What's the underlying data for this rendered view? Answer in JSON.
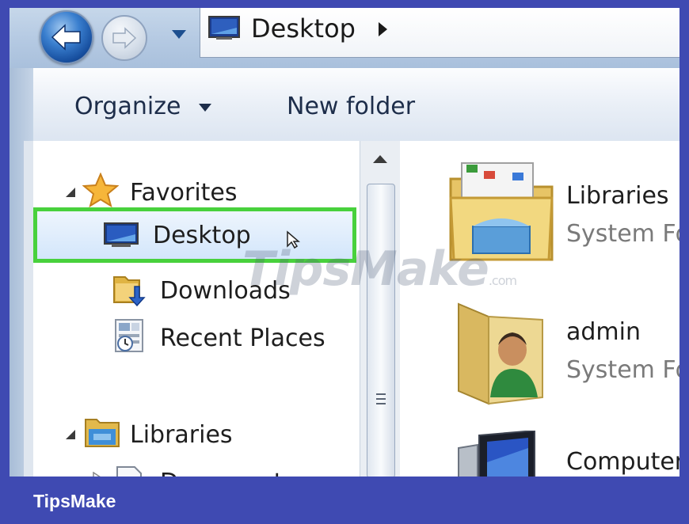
{
  "navigation": {
    "back_icon": "back-arrow-icon",
    "forward_icon": "forward-arrow-icon",
    "recent_pages_icon": "chevron-down-icon"
  },
  "address_bar": {
    "location_icon": "desktop-icon",
    "location": "Desktop",
    "separator_icon": "chevron-right-icon"
  },
  "toolbar": {
    "organize_label": "Organize",
    "new_folder_label": "New folder"
  },
  "nav_pane": {
    "favorites": {
      "label": "Favorites",
      "icon": "star-icon",
      "items": [
        {
          "label": "Desktop",
          "icon": "desktop-icon",
          "selected": true
        },
        {
          "label": "Downloads",
          "icon": "downloads-icon"
        },
        {
          "label": "Recent Places",
          "icon": "recent-places-icon"
        }
      ]
    },
    "libraries": {
      "label": "Libraries",
      "icon": "libraries-icon",
      "items": [
        {
          "label": "Documents",
          "icon": "documents-icon"
        }
      ]
    }
  },
  "content": {
    "items": [
      {
        "name": "Libraries",
        "type": "System Fo",
        "icon": "libraries-folder-icon"
      },
      {
        "name": "admin",
        "type": "System Fo",
        "icon": "user-folder-icon"
      },
      {
        "name": "Computer",
        "type": "",
        "icon": "computer-icon"
      }
    ]
  },
  "watermark": {
    "text": "TipsMake",
    "suffix": ".com"
  },
  "footer": {
    "brand": "TipsMake"
  },
  "colors": {
    "footer_background": "#3f4ab2",
    "highlight_border": "#48d13c",
    "selection_fill": "#d3e6fb"
  }
}
